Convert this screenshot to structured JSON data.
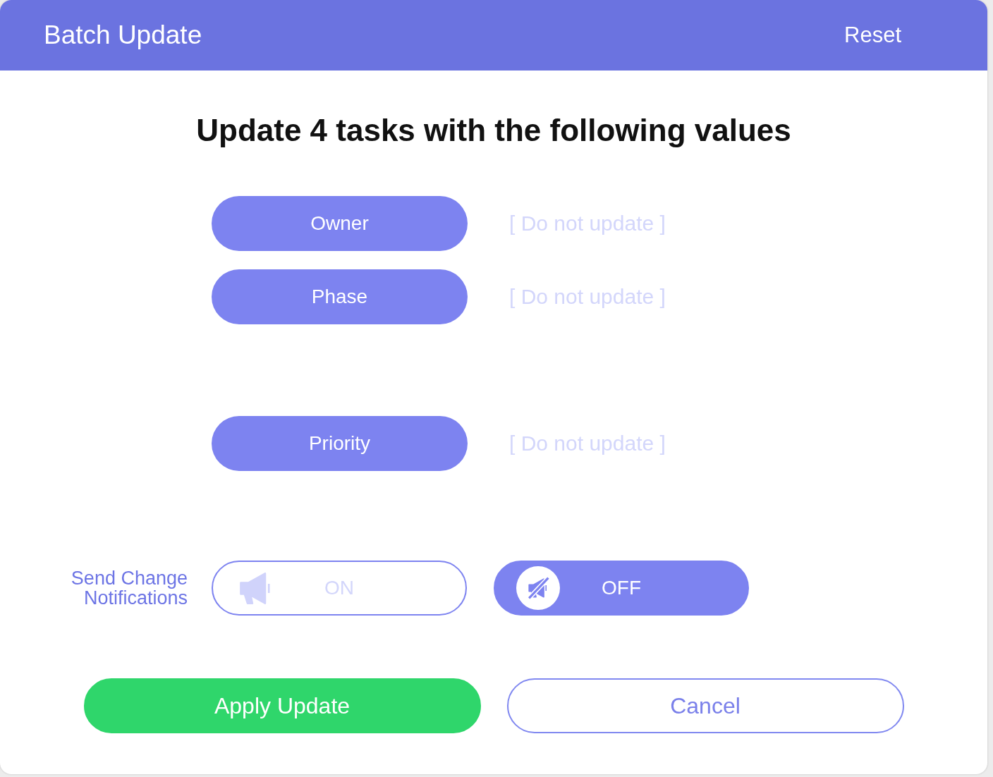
{
  "dialog": {
    "title": "Batch Update",
    "reset_link": "Reset"
  },
  "heading": "Update 4 tasks with the following values",
  "field_groups": [
    [
      {
        "label": "Owner",
        "value": "[ Do not update ]"
      },
      {
        "label": "Phase",
        "value": "[ Do not update ]"
      }
    ],
    [
      {
        "label": "Priority",
        "value": "[ Do not update ]"
      }
    ]
  ],
  "notifications": {
    "label": "Send Change Notifications",
    "options": [
      {
        "kind": "on",
        "label": "ON",
        "selected": false
      },
      {
        "kind": "off",
        "label": "OFF",
        "selected": true
      }
    ]
  },
  "actions": [
    {
      "kind": "primary",
      "label": "Apply Update"
    },
    {
      "kind": "secondary",
      "label": "Cancel"
    }
  ]
}
